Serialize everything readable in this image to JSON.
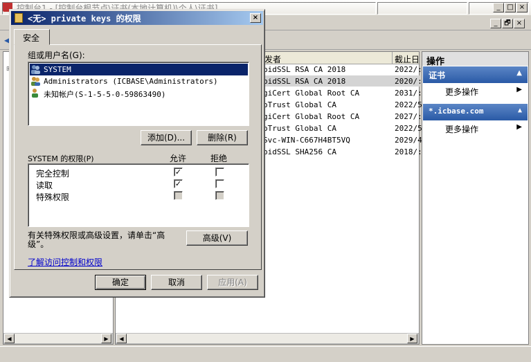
{
  "main_window": {
    "title": "控制台1 - [控制台根节点\\证书(本地计算机)\\个人\\证书]",
    "controls": {
      "minimize": "_",
      "restore": "□",
      "close": "×"
    },
    "inner_controls": {
      "minimize": "_",
      "restore": "🗗",
      "close": "×"
    }
  },
  "list": {
    "columns": [
      {
        "label": "发者"
      },
      {
        "label": "截止日"
      }
    ],
    "rows": [
      {
        "issuer": "pidSSL RSA CA 2018",
        "expires": "2022/:"
      },
      {
        "issuer": "pidSSL RSA CA 2018",
        "expires": "2020/:"
      },
      {
        "issuer": "giCert Global Root CA",
        "expires": "2031/:"
      },
      {
        "issuer": "oTrust Global CA",
        "expires": "2022/5"
      },
      {
        "issuer": "giCert Global Root CA",
        "expires": "2027/:"
      },
      {
        "issuer": "oTrust Global CA",
        "expires": "2022/5"
      },
      {
        "issuer": "Svc-WIN-C667H4BT5VQ",
        "expires": "2029/4"
      },
      {
        "issuer": "pidSSL SHA256 CA",
        "expires": "2018/:"
      }
    ]
  },
  "actions": {
    "header": "操作",
    "groups": [
      {
        "title": "证书",
        "item": "更多操作"
      },
      {
        "title": "*.icbase.com",
        "item": "更多操作"
      }
    ]
  },
  "dialog": {
    "title": "<无> private keys 的权限",
    "close": "×",
    "tab": "安全",
    "group_label": "组或用户名(G):",
    "users": [
      {
        "name": "SYSTEM",
        "selected": true
      },
      {
        "name": "Administrators (ICBASE\\Administrators)",
        "selected": false
      },
      {
        "name": "未知帐户(S-1-5-5-0-59863490)",
        "selected": false
      }
    ],
    "add_button": "添加(D)...",
    "remove_button": "删除(R)",
    "perm_label": "SYSTEM 的权限(P)",
    "allow_header": "允许",
    "deny_header": "拒绝",
    "permissions": [
      {
        "name": "完全控制",
        "allow": true,
        "deny": false,
        "disabled": false
      },
      {
        "name": "读取",
        "allow": true,
        "deny": false,
        "disabled": false
      },
      {
        "name": "特殊权限",
        "allow": false,
        "deny": false,
        "disabled": true
      }
    ],
    "advanced_text_line1": "有关特殊权限或高级设置，请单击“高",
    "advanced_text_line2": "级”。",
    "advanced_button": "高级(V)",
    "learn_link": "了解访问控制和权限",
    "ok_button": "确定",
    "cancel_button": "取消",
    "apply_button": "应用(A)"
  },
  "colors": {
    "selection": "#0a246a",
    "action_group": "#2a5aa6",
    "link": "#0000cc"
  }
}
